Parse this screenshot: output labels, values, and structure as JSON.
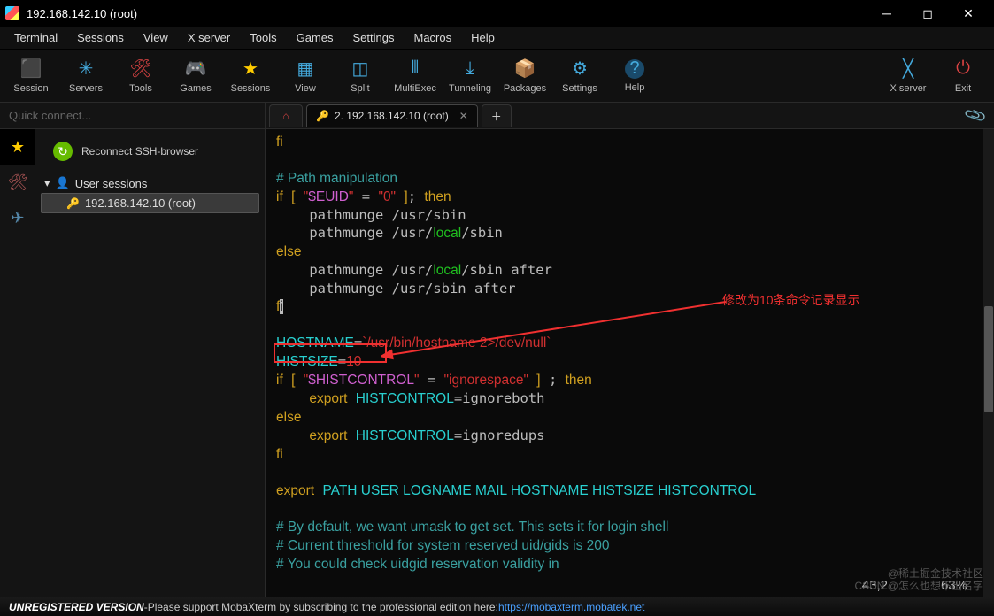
{
  "window": {
    "title": "192.168.142.10 (root)"
  },
  "menu": {
    "items": [
      "Terminal",
      "Sessions",
      "View",
      "X server",
      "Tools",
      "Games",
      "Settings",
      "Macros",
      "Help"
    ]
  },
  "toolbar": {
    "left": [
      {
        "name": "session",
        "label": "Session",
        "icon": "👥",
        "color": "#4ad"
      },
      {
        "name": "servers",
        "label": "Servers",
        "icon": "✳",
        "color": "#4ad"
      },
      {
        "name": "tools",
        "label": "Tools",
        "icon": "🛠",
        "color": "#d44"
      },
      {
        "name": "games",
        "label": "Games",
        "icon": "🎮",
        "color": "#ccc"
      },
      {
        "name": "sessions",
        "label": "Sessions",
        "icon": "★",
        "color": "#fc0"
      },
      {
        "name": "view",
        "label": "View",
        "icon": "▦",
        "color": "#4ad"
      },
      {
        "name": "split",
        "label": "Split",
        "icon": "◫",
        "color": "#4ad"
      },
      {
        "name": "multiexec",
        "label": "MultiExec",
        "icon": "⫴",
        "color": "#4ad"
      },
      {
        "name": "tunneling",
        "label": "Tunneling",
        "icon": "⤓",
        "color": "#4ad"
      },
      {
        "name": "packages",
        "label": "Packages",
        "icon": "📦",
        "color": "#a84"
      },
      {
        "name": "settings",
        "label": "Settings",
        "icon": "⚙",
        "color": "#4ad"
      },
      {
        "name": "help",
        "label": "Help",
        "icon": "?",
        "color": "#4ad"
      }
    ],
    "right": [
      {
        "name": "xserver",
        "label": "X server",
        "icon": "✕",
        "color": "#4ad"
      },
      {
        "name": "exit",
        "label": "Exit",
        "icon": "⏻",
        "color": "#d44"
      }
    ]
  },
  "sidebar": {
    "quick_placeholder": "Quick connect...",
    "reconnect_label": "Reconnect SSH-browser",
    "tree": {
      "folder_label": "User sessions",
      "session_label": "192.168.142.10 (root)"
    }
  },
  "tabs": {
    "active_label": "2. 192.168.142.10 (root)"
  },
  "terminal": {
    "lines_raw": "see rendered block",
    "annotation_text": "修改为10条命令记录显示",
    "cursor_pos": "43,2",
    "scroll_pct": "63%"
  },
  "statusbar": {
    "unreg": "UNREGISTERED VERSION",
    "sep": "  -  ",
    "msg": "Please support MobaXterm by subscribing to the professional edition here: ",
    "link": "https://mobaxterm.mobatek.net"
  },
  "watermarks": {
    "w1": "CSDN @怎么也想不出名字",
    "w2": "@稀土掘金技术社区"
  }
}
